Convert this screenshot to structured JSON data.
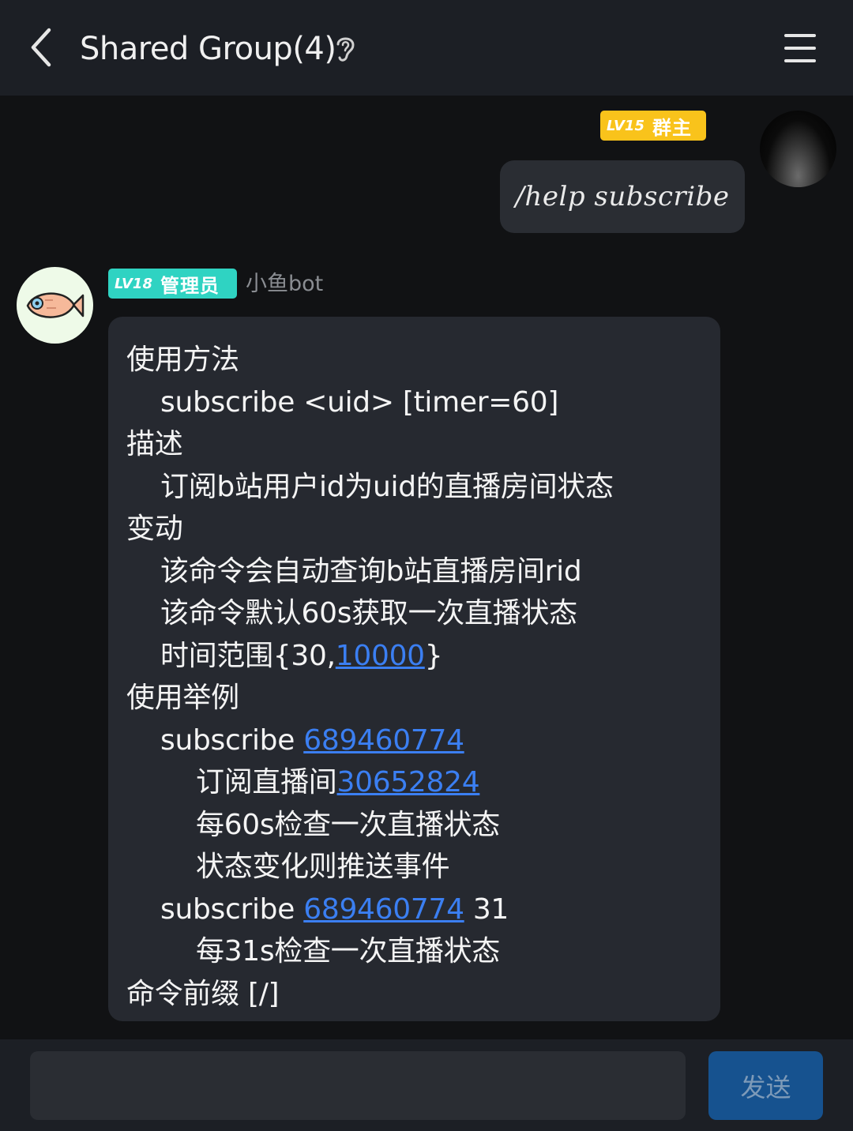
{
  "header": {
    "title": "Shared Group(4)",
    "back_icon": "chevron-left-icon",
    "ear_icon": "ear-icon",
    "menu_icon": "menu-icon"
  },
  "messages": [
    {
      "sender": "self",
      "badge_level": "LV15",
      "badge_role": "群主",
      "badge_color": "#f9c31b",
      "text": "/help subscribe"
    },
    {
      "sender": "bot",
      "name": "小鱼bot",
      "badge_level": "LV18",
      "badge_role": "管理员",
      "badge_color": "#2fd3c2",
      "lines": {
        "l1": "使用方法",
        "l2": "subscribe <uid> [timer=60]",
        "l3": "描述",
        "l4": "订阅b站用户id为uid的直播房间状态",
        "l5": "变动",
        "l6": "该命令会自动查询b站直播房间rid",
        "l7": "该命令默认60s获取一次直播状态",
        "l8_pre": "时间范围{30,",
        "l8_link": "10000",
        "l8_post": "}",
        "l9": "使用举例",
        "l10_pre": "subscribe ",
        "l10_link": "689460774",
        "l11_pre": "订阅直播间",
        "l11_link": "30652824",
        "l12": "每60s检查一次直播状态",
        "l13": "状态变化则推送事件",
        "l14_pre": "subscribe ",
        "l14_link": "689460774",
        "l14_post": " 31",
        "l15": "每31s检查一次直播状态",
        "l16": "命令前缀 [/]"
      }
    }
  ],
  "composer": {
    "value": "",
    "send_label": "发送"
  },
  "colors": {
    "link": "#3b7ff2",
    "background": "#111214",
    "bubble": "#262930",
    "send_button": "#16528f"
  }
}
